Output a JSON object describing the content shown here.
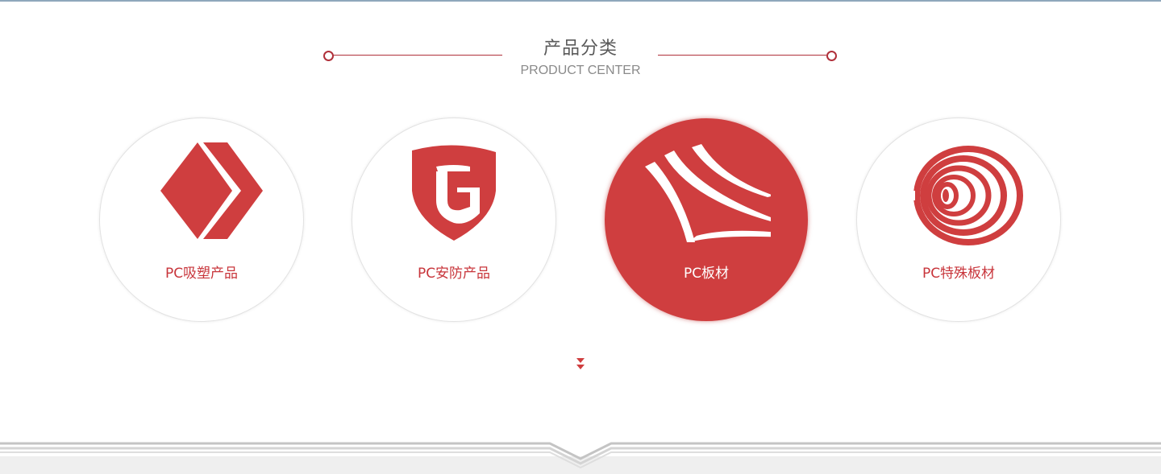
{
  "section": {
    "title_cn": "产品分类",
    "title_en": "PRODUCT CENTER"
  },
  "categories": [
    {
      "label": "PC吸塑产品",
      "icon": "chevron-diamond-icon",
      "active": false
    },
    {
      "label": "PC安防产品",
      "icon": "g-shield-icon",
      "active": false
    },
    {
      "label": "PC板材",
      "icon": "curved-panels-icon",
      "active": true
    },
    {
      "label": "PC特殊板材",
      "icon": "concentric-arcs-icon",
      "active": false
    }
  ],
  "colors": {
    "accent": "#cf3e3f",
    "line": "#b0303a",
    "title": "#5a5a5a",
    "subtitle": "#8a8a8a"
  }
}
